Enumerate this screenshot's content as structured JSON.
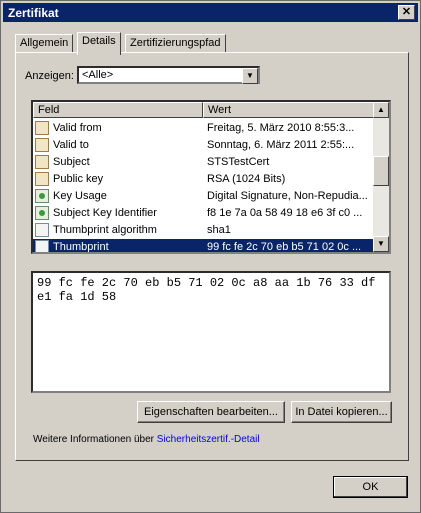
{
  "window": {
    "title": "Zertifikat",
    "close_label": "✕"
  },
  "tabs": [
    {
      "label": "Allgemein"
    },
    {
      "label": "Details"
    },
    {
      "label": "Zertifizierungspfad"
    }
  ],
  "filter": {
    "label": "Anzeigen:",
    "value": "<Alle>"
  },
  "list": {
    "columns": [
      "Feld",
      "Wert"
    ],
    "rows": [
      {
        "field": "Valid from",
        "value": "Freitag, 5. März 2010   8:55:3...",
        "icon": "certificate-field-icon"
      },
      {
        "field": "Valid to",
        "value": "Sonntag, 6. März 2011   2:55:...",
        "icon": "certificate-field-icon"
      },
      {
        "field": "Subject",
        "value": "STSTestCert",
        "icon": "certificate-field-icon"
      },
      {
        "field": "Public key",
        "value": "RSA (1024 Bits)",
        "icon": "certificate-field-icon"
      },
      {
        "field": "Key Usage",
        "value": "Digital Signature, Non-Repudia...",
        "icon": "extension-icon"
      },
      {
        "field": "Subject Key Identifier",
        "value": "f8 1e 7a 0a 58 49 18 e6 3f c0 ...",
        "icon": "extension-icon"
      },
      {
        "field": "Thumbprint algorithm",
        "value": "sha1",
        "icon": "property-icon"
      },
      {
        "field": "Thumbprint",
        "value": "99 fc fe 2c 70 eb b5 71 02 0c ...",
        "icon": "property-icon",
        "selected": true
      }
    ]
  },
  "detail_text": "99 fc fe 2c 70 eb b5 71 02 0c a8 aa 1b 76 33 df e1 fa 1d 58",
  "buttons": {
    "edit_properties": "Eigenschaften bearbeiten...",
    "copy_to_file": "In Datei kopieren...",
    "ok": "OK"
  },
  "info": {
    "text": "Weitere Informationen über ",
    "link": "Sicherheitszertif.-Detail"
  },
  "colors": {
    "title_bar": "#0a246a",
    "selection": "#0a246a",
    "dialog_bg": "#d4d0c8",
    "link": "#0000ee"
  }
}
